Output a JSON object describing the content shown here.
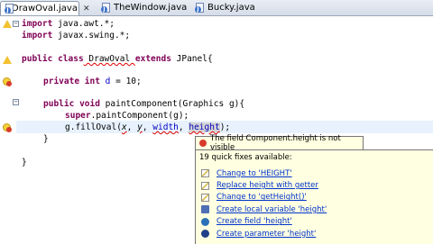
{
  "tabs": [
    {
      "label": "*DrawOval.java",
      "active": true
    },
    {
      "label": "TheWindow.java",
      "active": false
    },
    {
      "label": "Bucky.java",
      "active": false
    }
  ],
  "tab_close_glyph": "✕",
  "code_lines": {
    "l1_kw": "import",
    "l1_rest": " java.awt.*;",
    "l2_kw": "import",
    "l2_rest": " javax.swing.*;",
    "l3_kw1": "public",
    "l3_kw2": "class",
    "l3_name": " DrawOval ",
    "l3_kw3": "extends",
    "l3_rest": " JPanel{",
    "l4_kw1": "private",
    "l4_kw2": "int",
    "l4_fld": " d",
    "l4_rest": " = 10;",
    "l5_kw1": "public",
    "l5_kw2": "void",
    "l5_rest": " paintComponent(Graphics g){",
    "l6_kw": "super",
    "l6_rest": ".paintComponent(g);",
    "l7_a": "g.fillOval(",
    "l7_x": "x",
    "l7_c1": ", ",
    "l7_y": "y",
    "l7_c2": ", ",
    "l7_w": "width",
    "l7_c3": ", ",
    "l7_h": "height",
    "l7_end": ");",
    "l8": "}",
    "l9": "}"
  },
  "tooltip": {
    "text": "The field Component.height is not visible"
  },
  "quick_fix": {
    "header": "19 quick fixes available:",
    "items": [
      {
        "label": "Change to 'HEIGHT'",
        "icon": "change-icon"
      },
      {
        "label": "Replace height with getter",
        "icon": "change-icon"
      },
      {
        "label": "Change to 'getHeight()'",
        "icon": "change-icon"
      },
      {
        "label": "Create local variable 'height'",
        "icon": "local-variable-icon"
      },
      {
        "label": "Create field 'height'",
        "icon": "field-icon"
      },
      {
        "label": "Create parameter 'height'",
        "icon": "parameter-icon"
      }
    ]
  },
  "colors": {
    "keyword": "#7f0055",
    "field": "#0000c0",
    "link": "#0033cc",
    "tooltip_bg": "#ffffe1",
    "error": "#d83b2b"
  }
}
